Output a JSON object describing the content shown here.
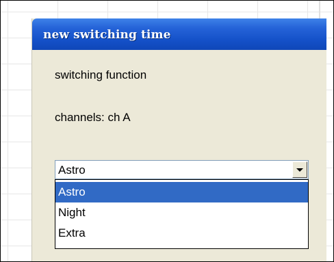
{
  "dialog": {
    "title": "new switching time",
    "function_label": "switching function",
    "channels_label": "channels: ch A"
  },
  "combo": {
    "value": "Astro",
    "icon": "chevron-down-icon"
  },
  "dropdown": {
    "options": [
      {
        "label": "Astro",
        "selected": true
      },
      {
        "label": "Night",
        "selected": false
      },
      {
        "label": "Extra",
        "selected": false
      }
    ]
  },
  "colors": {
    "title_bar": "#1450c8",
    "dialog_bg": "#ece9d8",
    "selection": "#316ac5"
  }
}
